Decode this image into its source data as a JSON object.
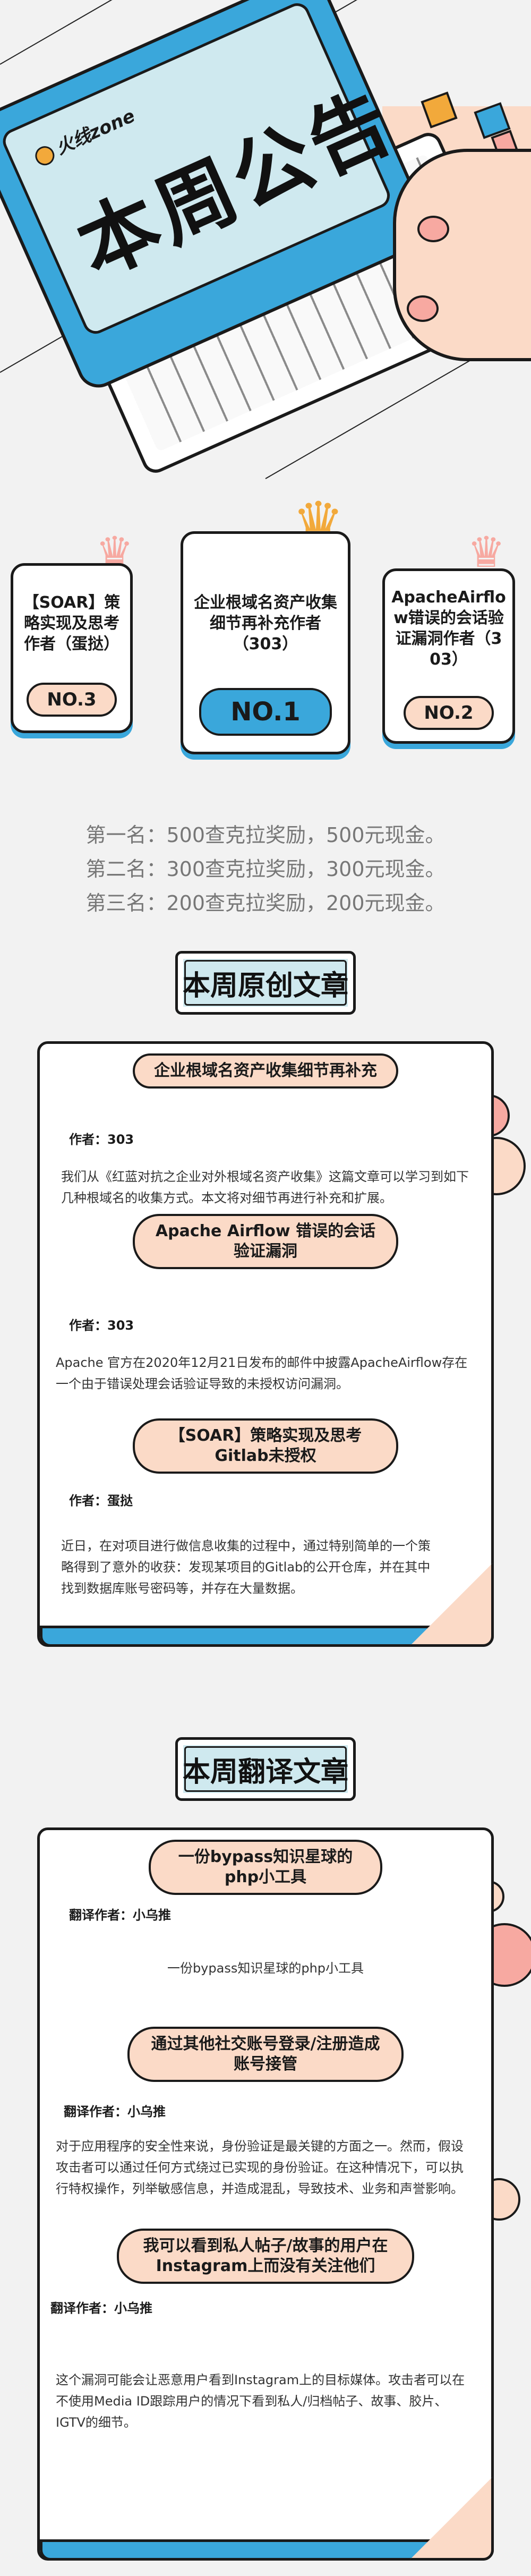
{
  "hero": {
    "brand": "火线zone",
    "headline": "本周公告"
  },
  "podium": {
    "left": {
      "title": "【SOAR】策略实现及思考作者（蛋挞）",
      "rank": "NO.3"
    },
    "center": {
      "title": "企业根域名资产收集细节再补充作者（303）",
      "rank": "NO.1"
    },
    "right": {
      "title": "ApacheAirflow错误的会话验证漏洞作者（303）",
      "rank": "NO.2"
    }
  },
  "prizes": [
    "第一名：500查克拉奖励，500元现金。",
    "第二名：300查克拉奖励，300元现金。",
    "第三名：200查克拉奖励，200元现金。"
  ],
  "original": {
    "title": "本周原创文章",
    "articles": [
      {
        "title": "企业根域名资产收集细节再补充",
        "author": "作者：303",
        "summary": "我们从《红蓝对抗之企业对外根域名资产收集》这篇文章可以学习到如下几种根域名的收集方式。本文将对细节再进行补充和扩展。"
      },
      {
        "title": "Apache Airflow 错误的会话验证漏洞",
        "author": "作者：303",
        "summary": "Apache 官方在2020年12月21日发布的邮件中披露ApacheAirflow存在一个由于错误处理会话验证导致的未授权访问漏洞。"
      },
      {
        "title": "【SOAR】策略实现及思考 Gitlab未授权",
        "author": "作者：蛋挞",
        "summary": "近日，在对项目进行做信息收集的过程中，通过特别简单的一个策略得到了意外的收获：发现某项目的Gitlab的公开仓库，并在其中找到数据库账号密码等，并存在大量数据。"
      }
    ]
  },
  "translated": {
    "title": "本周翻译文章",
    "articles": [
      {
        "title": "一份bypass知识星球的php小工具",
        "author": "翻译作者：小乌推",
        "summary": "一份bypass知识星球的php小工具"
      },
      {
        "title": "通过其他社交账号登录/注册造成账号接管",
        "author": "翻译作者：小乌推",
        "summary": "对于应用程序的安全性来说，身份验证是最关键的方面之一。然而，假设攻击者可以通过任何方式绕过已实现的身份验证。在这种情况下，可以执行特权操作，列举敏感信息，并造成混乱，导致技术、业务和声誉影响。"
      },
      {
        "title": "我可以看到私人帖子/故事的用户在Instagram上而没有关注他们",
        "author": "翻译作者：小乌推",
        "summary": "这个漏洞可能会让恶意用户看到Instagram上的目标媒体。攻击者可以在不使用Media ID跟踪用户的情况下看到私人/归档帖子、故事、胶片、IGTV的细节。"
      }
    ]
  },
  "colors": {
    "blue": "#3aa7db",
    "peach": "#fbdac7",
    "pink": "#f7a9a1",
    "orange": "#f2a93b",
    "light_blue": "#cfe9ef"
  }
}
